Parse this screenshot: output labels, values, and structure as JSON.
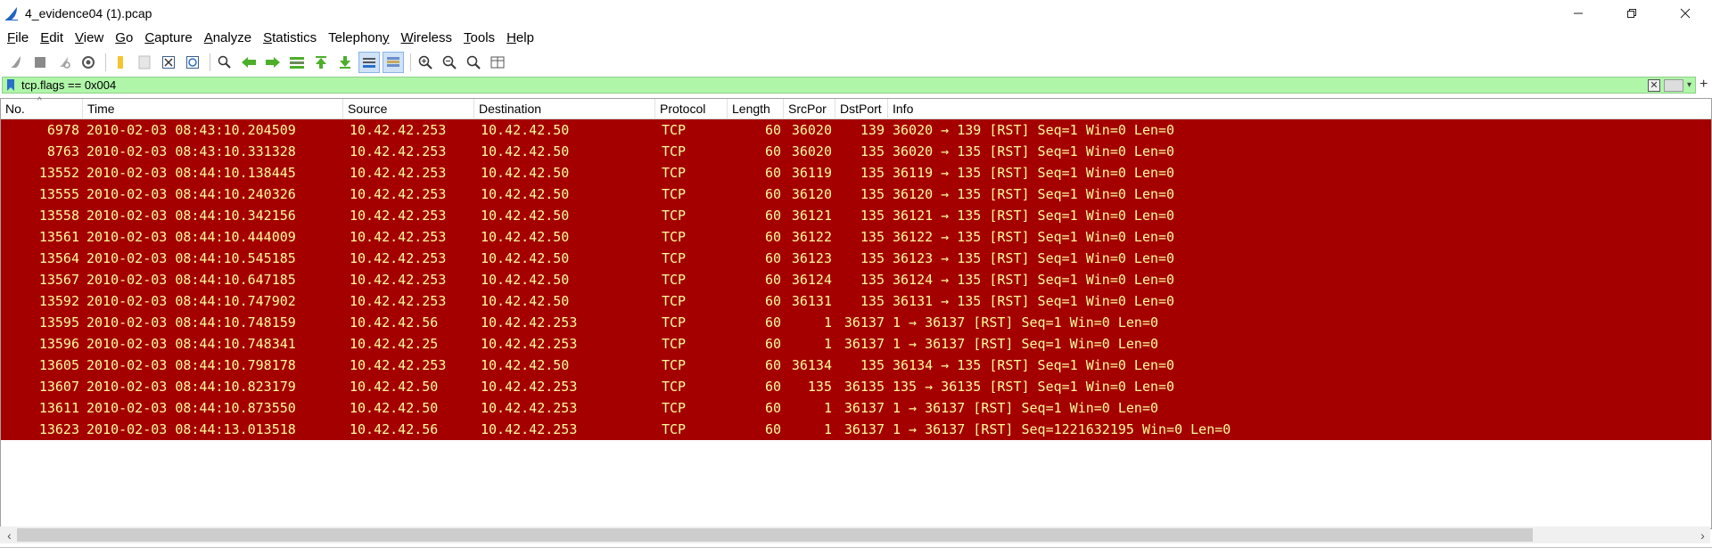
{
  "window": {
    "title": "4_evidence04 (1).pcap",
    "minimize": "–",
    "close": "×"
  },
  "menu": [
    {
      "label": "File",
      "ul": "F",
      "rest": "ile"
    },
    {
      "label": "Edit",
      "ul": "E",
      "rest": "dit"
    },
    {
      "label": "View",
      "ul": "V",
      "rest": "iew"
    },
    {
      "label": "Go",
      "ul": "G",
      "rest": "o"
    },
    {
      "label": "Capture",
      "ul": "C",
      "rest": "apture"
    },
    {
      "label": "Analyze",
      "ul": "A",
      "rest": "nalyze"
    },
    {
      "label": "Statistics",
      "ul": "S",
      "rest": "tatistics"
    },
    {
      "label": "Telephony",
      "ul": "y",
      "pre": "Telephon",
      "rest": ""
    },
    {
      "label": "Wireless",
      "ul": "W",
      "rest": "ireless"
    },
    {
      "label": "Tools",
      "ul": "T",
      "rest": "ools"
    },
    {
      "label": "Help",
      "ul": "H",
      "rest": "elp"
    }
  ],
  "toolbar": {
    "icons": [
      "shark-fin-start-icon",
      "stop-icon",
      "restart-icon",
      "capture-options-icon",
      "open-file-icon",
      "save-file-icon",
      "close-file-icon",
      "reload-icon",
      "find-packet-icon",
      "back-icon",
      "forward-icon",
      "go-to-packet-icon",
      "first-packet-icon",
      "last-packet-icon",
      "autoscroll-icon",
      "colorize-icon",
      "zoom-in-icon",
      "zoom-out-icon",
      "normal-size-icon",
      "resize-columns-icon"
    ]
  },
  "filter": {
    "value": "tcp.flags == 0x004",
    "plus": "+"
  },
  "columns": {
    "no": "No.",
    "time": "Time",
    "source": "Source",
    "destination": "Destination",
    "protocol": "Protocol",
    "length": "Length",
    "srcport": "SrcPor",
    "dstport": "DstPort",
    "info": "Info"
  },
  "colors": {
    "row_bg": "#a40000",
    "row_fg": "#fffc9c",
    "filter_bg": "#aff6a9"
  },
  "packets": [
    {
      "no": "6978",
      "time": "2010-02-03 08:43:10.204509",
      "src": "10.42.42.253",
      "dst": "10.42.42.50",
      "proto": "TCP",
      "len": "60",
      "sport": "36020",
      "dport": "139",
      "info": "36020 → 139 [RST] Seq=1 Win=0 Len=0"
    },
    {
      "no": "8763",
      "time": "2010-02-03 08:43:10.331328",
      "src": "10.42.42.253",
      "dst": "10.42.42.50",
      "proto": "TCP",
      "len": "60",
      "sport": "36020",
      "dport": "135",
      "info": "36020 → 135 [RST] Seq=1 Win=0 Len=0"
    },
    {
      "no": "13552",
      "time": "2010-02-03 08:44:10.138445",
      "src": "10.42.42.253",
      "dst": "10.42.42.50",
      "proto": "TCP",
      "len": "60",
      "sport": "36119",
      "dport": "135",
      "info": "36119 → 135 [RST] Seq=1 Win=0 Len=0"
    },
    {
      "no": "13555",
      "time": "2010-02-03 08:44:10.240326",
      "src": "10.42.42.253",
      "dst": "10.42.42.50",
      "proto": "TCP",
      "len": "60",
      "sport": "36120",
      "dport": "135",
      "info": "36120 → 135 [RST] Seq=1 Win=0 Len=0"
    },
    {
      "no": "13558",
      "time": "2010-02-03 08:44:10.342156",
      "src": "10.42.42.253",
      "dst": "10.42.42.50",
      "proto": "TCP",
      "len": "60",
      "sport": "36121",
      "dport": "135",
      "info": "36121 → 135 [RST] Seq=1 Win=0 Len=0"
    },
    {
      "no": "13561",
      "time": "2010-02-03 08:44:10.444009",
      "src": "10.42.42.253",
      "dst": "10.42.42.50",
      "proto": "TCP",
      "len": "60",
      "sport": "36122",
      "dport": "135",
      "info": "36122 → 135 [RST] Seq=1 Win=0 Len=0"
    },
    {
      "no": "13564",
      "time": "2010-02-03 08:44:10.545185",
      "src": "10.42.42.253",
      "dst": "10.42.42.50",
      "proto": "TCP",
      "len": "60",
      "sport": "36123",
      "dport": "135",
      "info": "36123 → 135 [RST] Seq=1 Win=0 Len=0"
    },
    {
      "no": "13567",
      "time": "2010-02-03 08:44:10.647185",
      "src": "10.42.42.253",
      "dst": "10.42.42.50",
      "proto": "TCP",
      "len": "60",
      "sport": "36124",
      "dport": "135",
      "info": "36124 → 135 [RST] Seq=1 Win=0 Len=0"
    },
    {
      "no": "13592",
      "time": "2010-02-03 08:44:10.747902",
      "src": "10.42.42.253",
      "dst": "10.42.42.50",
      "proto": "TCP",
      "len": "60",
      "sport": "36131",
      "dport": "135",
      "info": "36131 → 135 [RST] Seq=1 Win=0 Len=0"
    },
    {
      "no": "13595",
      "time": "2010-02-03 08:44:10.748159",
      "src": "10.42.42.56",
      "dst": "10.42.42.253",
      "proto": "TCP",
      "len": "60",
      "sport": "1",
      "dport": "36137",
      "info": "1 → 36137 [RST] Seq=1 Win=0 Len=0"
    },
    {
      "no": "13596",
      "time": "2010-02-03 08:44:10.748341",
      "src": "10.42.42.25",
      "dst": "10.42.42.253",
      "proto": "TCP",
      "len": "60",
      "sport": "1",
      "dport": "36137",
      "info": "1 → 36137 [RST] Seq=1 Win=0 Len=0"
    },
    {
      "no": "13605",
      "time": "2010-02-03 08:44:10.798178",
      "src": "10.42.42.253",
      "dst": "10.42.42.50",
      "proto": "TCP",
      "len": "60",
      "sport": "36134",
      "dport": "135",
      "info": "36134 → 135 [RST] Seq=1 Win=0 Len=0"
    },
    {
      "no": "13607",
      "time": "2010-02-03 08:44:10.823179",
      "src": "10.42.42.50",
      "dst": "10.42.42.253",
      "proto": "TCP",
      "len": "60",
      "sport": "135",
      "dport": "36135",
      "info": "135 → 36135 [RST] Seq=1 Win=0 Len=0"
    },
    {
      "no": "13611",
      "time": "2010-02-03 08:44:10.873550",
      "src": "10.42.42.50",
      "dst": "10.42.42.253",
      "proto": "TCP",
      "len": "60",
      "sport": "1",
      "dport": "36137",
      "info": "1 → 36137 [RST] Seq=1 Win=0 Len=0"
    },
    {
      "no": "13623",
      "time": "2010-02-03 08:44:13.013518",
      "src": "10.42.42.56",
      "dst": "10.42.42.253",
      "proto": "TCP",
      "len": "60",
      "sport": "1",
      "dport": "36137",
      "info": "1 → 36137 [RST] Seq=1221632195 Win=0 Len=0"
    }
  ]
}
